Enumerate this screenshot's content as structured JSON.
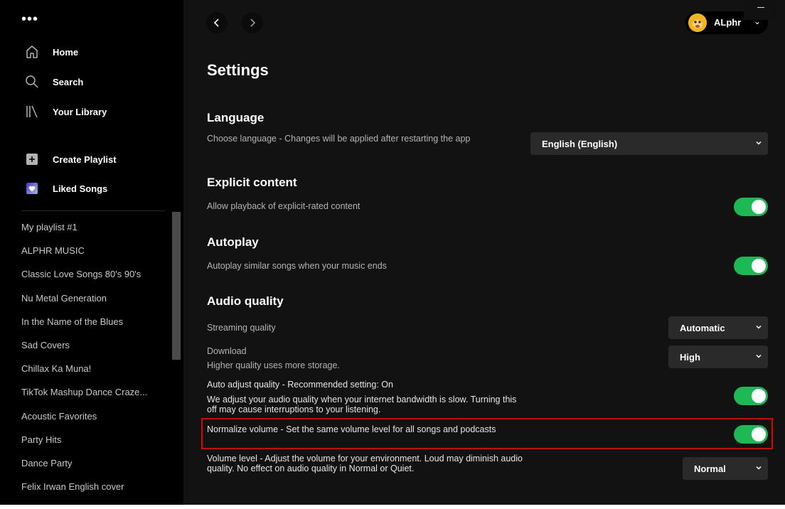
{
  "sidebar": {
    "menu_dots": "•••",
    "nav": [
      {
        "label": "Home",
        "icon": "home-icon"
      },
      {
        "label": "Search",
        "icon": "search-icon"
      },
      {
        "label": "Your Library",
        "icon": "library-icon"
      }
    ],
    "actions": [
      {
        "label": "Create Playlist",
        "icon": "plus-icon"
      },
      {
        "label": "Liked Songs",
        "icon": "heart-icon"
      }
    ],
    "playlists": [
      "My playlist #1",
      "ALPHR MUSIC",
      "Classic Love Songs 80's 90's",
      "Nu Metal Generation",
      "In the Name of the Blues",
      "Sad Covers",
      "Chillax Ka Muna!",
      "TikTok Mashup Dance Craze...",
      "Acoustic Favorites",
      "Party Hits",
      "Dance Party",
      "Felix Irwan English cover"
    ]
  },
  "topbar": {
    "back_icon": "chevron-left-icon",
    "forward_icon": "chevron-right-icon",
    "user_name": "ALphr",
    "user_caret": "⌄"
  },
  "settings": {
    "title": "Settings",
    "language": {
      "heading": "Language",
      "description": "Choose language - Changes will be applied after restarting the app",
      "value": "English (English)"
    },
    "explicit": {
      "heading": "Explicit content",
      "description": "Allow playback of explicit-rated content",
      "enabled": true
    },
    "autoplay": {
      "heading": "Autoplay",
      "description": "Autoplay similar songs when your music ends",
      "enabled": true
    },
    "audio": {
      "heading": "Audio quality",
      "streaming": {
        "label": "Streaming quality",
        "value": "Automatic"
      },
      "download": {
        "label": "Download",
        "sublabel": "Higher quality uses more storage.",
        "value": "High"
      },
      "auto_adjust": {
        "label": "Auto adjust quality - Recommended setting: On",
        "sublabel": "We adjust your audio quality when your internet bandwidth is slow. Turning this off may cause interruptions to your listening.",
        "enabled": true
      },
      "normalize": {
        "label": "Normalize volume - Set the same volume level for all songs and podcasts",
        "enabled": true
      },
      "volume_level": {
        "label": "Volume level - Adjust the volume for your environment. Loud may diminish audio quality. No effect on audio quality in Normal or Quiet.",
        "value": "Normal"
      }
    }
  },
  "colors": {
    "accent_green": "#1db954",
    "highlight_red": "#e00000",
    "sidebar_bg": "#000000",
    "main_bg": "#121212"
  }
}
